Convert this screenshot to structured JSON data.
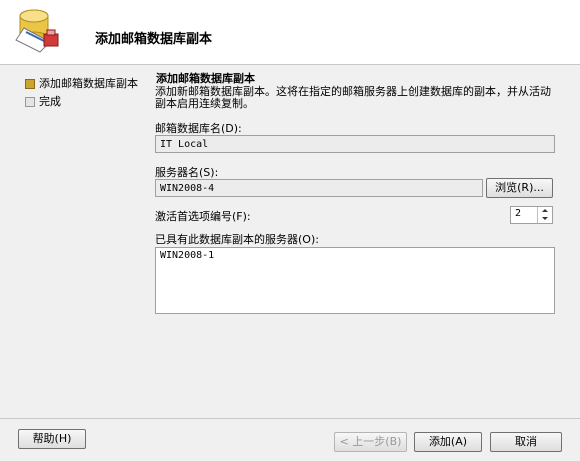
{
  "header": {
    "title": "添加邮箱数据库副本"
  },
  "nav": {
    "items": [
      {
        "label": "添加邮箱数据库副本",
        "state": "active"
      },
      {
        "label": "完成",
        "state": "pending"
      }
    ]
  },
  "content": {
    "title": "添加邮箱数据库副本",
    "description": "添加新邮箱数据库副本。这将在指定的邮箱服务器上创建数据库的副本，并从活动副本启用连续复制。",
    "db_name_label": "邮箱数据库名(D):",
    "db_name_value": "IT Local",
    "server_label": "服务器名(S):",
    "server_value": "WIN2008-4",
    "browse_label": "浏览(R)...",
    "activation_label": "激活首选项编号(F):",
    "activation_value": "2",
    "existing_label": "已具有此数据库副本的服务器(O):",
    "existing_servers": [
      "WIN2008-1"
    ]
  },
  "footer": {
    "help": "帮助(H)",
    "back": "< 上一步(B)",
    "add": "添加(A)",
    "cancel": "取消"
  },
  "colors": {
    "accent": "#c9a535",
    "header_bg": "#ffffff",
    "dialog_bg": "#f0f0f0"
  },
  "icons": {
    "header": "database-icon"
  }
}
